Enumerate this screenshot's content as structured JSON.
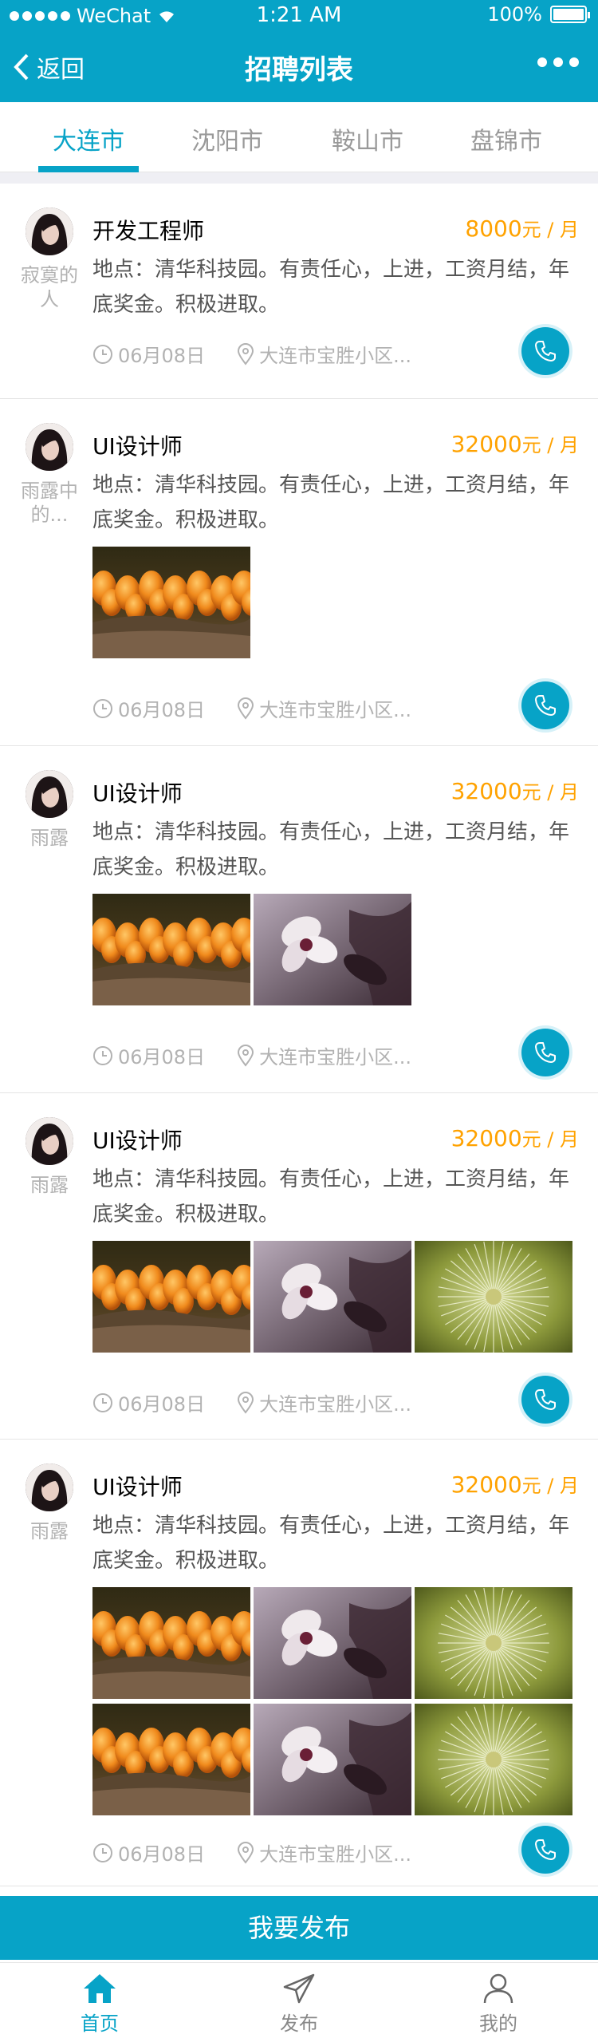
{
  "status_bar": {
    "carrier": "WeChat",
    "time": "1:21 AM",
    "battery": "100%"
  },
  "nav": {
    "back_label": "返回",
    "title": "招聘列表"
  },
  "city_tabs": [
    "大连市",
    "沈阳市",
    "鞍山市",
    "盘锦市"
  ],
  "active_city": "大连市",
  "posts": [
    {
      "poster": "寂寞的人",
      "title": "开发工程师",
      "salary": "8000",
      "salary_unit": "元 / 月",
      "description": "地点：清华科技园。有责任心，上进，工资月结，年底奖金。积极进取。",
      "date": "06月08日",
      "location": "大连市宝胜小区...",
      "image_count": 0
    },
    {
      "poster": "雨露中的...",
      "title": "UI设计师",
      "salary": "32000",
      "salary_unit": "元 / 月",
      "description": "地点：清华科技园。有责任心，上进，工资月结，年底奖金。积极进取。",
      "date": "06月08日",
      "location": "大连市宝胜小区...",
      "image_count": 1
    },
    {
      "poster": "雨露",
      "title": "UI设计师",
      "salary": "32000",
      "salary_unit": "元 / 月",
      "description": "地点：清华科技园。有责任心，上进，工资月结，年底奖金。积极进取。",
      "date": "06月08日",
      "location": "大连市宝胜小区...",
      "image_count": 2
    },
    {
      "poster": "雨露",
      "title": "UI设计师",
      "salary": "32000",
      "salary_unit": "元 / 月",
      "description": "地点：清华科技园。有责任心，上进，工资月结，年底奖金。积极进取。",
      "date": "06月08日",
      "location": "大连市宝胜小区...",
      "image_count": 3
    },
    {
      "poster": "雨露",
      "title": "UI设计师",
      "salary": "32000",
      "salary_unit": "元 / 月",
      "description": "地点：清华科技园。有责任心，上进，工资月结，年底奖金。积极进取。",
      "date": "06月08日",
      "location": "大连市宝胜小区...",
      "image_count": 6
    }
  ],
  "publish_button": "我要发布",
  "tabbar": [
    {
      "label": "首页",
      "icon": "home-icon",
      "active": true
    },
    {
      "label": "发布",
      "icon": "send-icon",
      "active": false
    },
    {
      "label": "我的",
      "icon": "user-icon",
      "active": false
    }
  ],
  "colors": {
    "brand": "#07a3c7",
    "salary": "#ffa200",
    "muted": "#b2b2b2",
    "divider": "#e5e5e5",
    "gap": "#efeff4"
  }
}
